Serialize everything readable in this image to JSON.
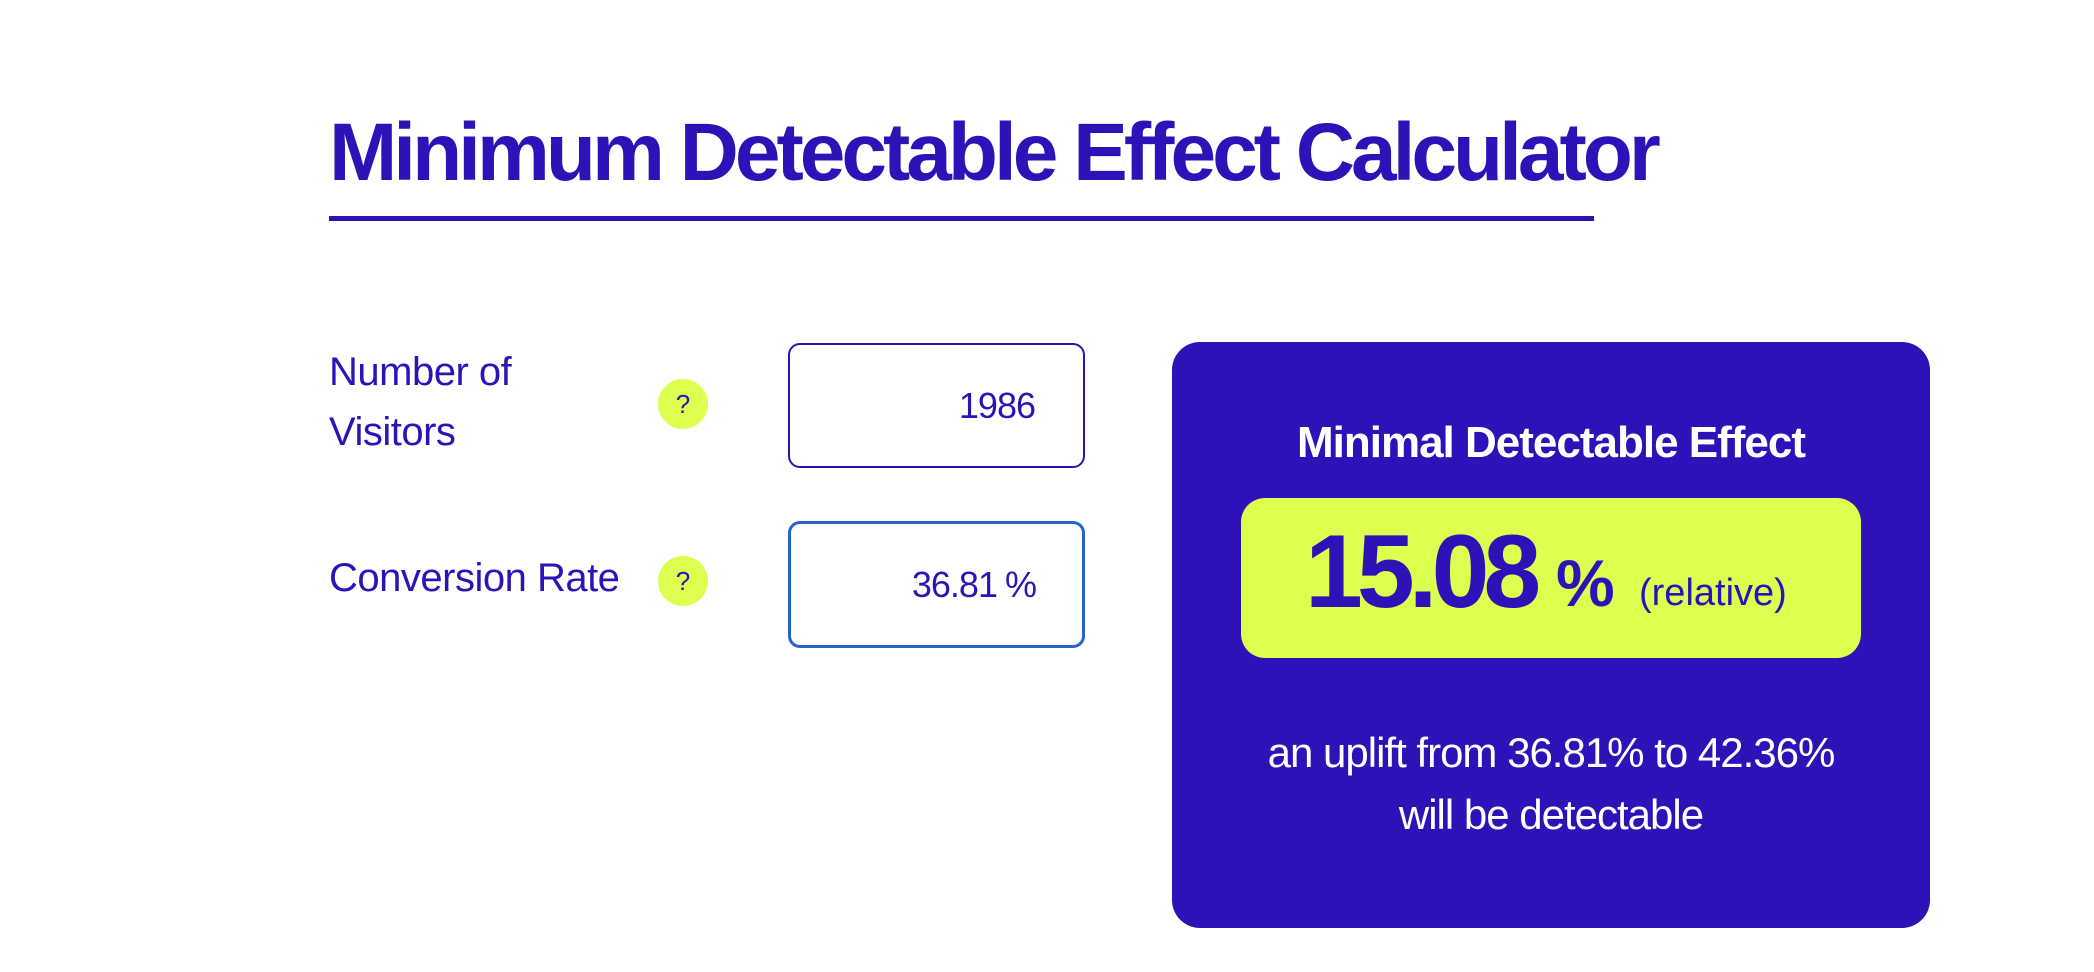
{
  "page": {
    "title": "Minimum Detectable Effect Calculator"
  },
  "inputs": {
    "visitors": {
      "label_line1": "Number of",
      "label_line2": "Visitors",
      "help": "?",
      "value": "1986"
    },
    "conversion_rate": {
      "label": "Conversion Rate",
      "help": "?",
      "value": "36.81",
      "unit": "%"
    }
  },
  "result": {
    "heading": "Minimal Detectable Effect",
    "value": "15.08",
    "percent": "%",
    "qualifier": "(relative)",
    "description_line1": "an uplift from 36.81% to 42.36%",
    "description_line2": "will be detectable"
  },
  "colors": {
    "primary": "#2e12b8",
    "accent": "#ddff4f",
    "focus_border": "#2565c7",
    "background": "#ffffff"
  }
}
